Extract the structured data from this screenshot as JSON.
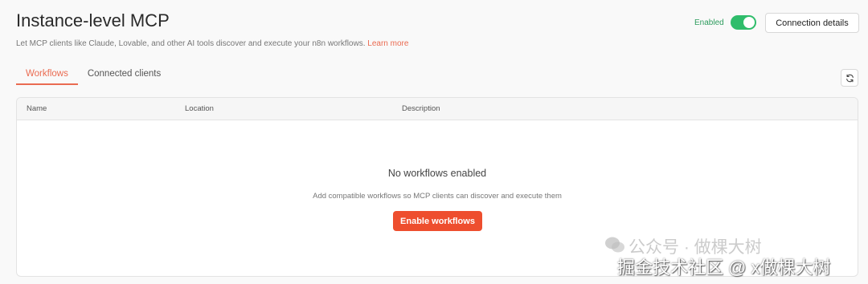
{
  "header": {
    "title": "Instance-level MCP",
    "subtitle": "Let MCP clients like Claude, Lovable, and other AI tools discover and execute your n8n workflows.",
    "learn_more": "Learn more",
    "enabled_label": "Enabled",
    "toggle_on": true,
    "connection_button": "Connection details"
  },
  "tabs": [
    {
      "label": "Workflows",
      "active": true
    },
    {
      "label": "Connected clients",
      "active": false
    }
  ],
  "refresh_icon": "refresh-icon",
  "table": {
    "columns": [
      "Name",
      "Location",
      "Description"
    ],
    "rows": []
  },
  "empty_state": {
    "title": "No workflows enabled",
    "description": "Add compatible workflows so MCP clients can discover and execute them",
    "button": "Enable workflows"
  },
  "watermark": {
    "line1": "公众号 · 做棵大树",
    "line2": "掘金技术社区 @ x做棵大树"
  },
  "colors": {
    "accent": "#ea6b51",
    "primary_button": "#ee4e2e",
    "toggle": "#2fbd6b",
    "enabled_text": "#2e9c5e"
  }
}
